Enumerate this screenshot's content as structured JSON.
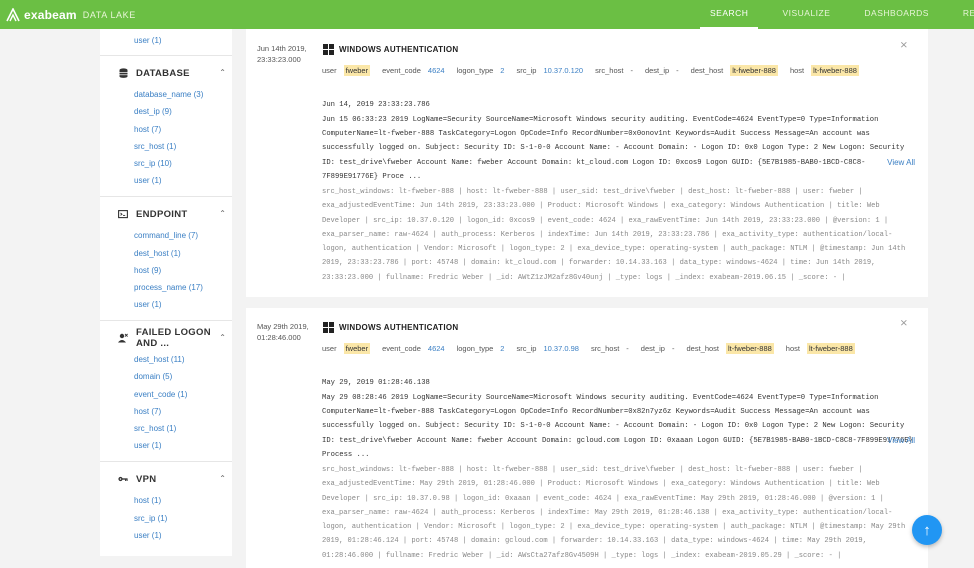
{
  "brand": {
    "name": "exabeam",
    "product": "DATA LAKE"
  },
  "nav": [
    "SEARCH",
    "VISUALIZE",
    "DASHBOARDS",
    "REPORTS"
  ],
  "sidebar": {
    "top_item": "user (1)",
    "database": {
      "title": "DATABASE",
      "items": [
        "database_name (3)",
        "dest_ip (9)",
        "host (7)",
        "src_host (1)",
        "src_ip (10)",
        "user (1)"
      ]
    },
    "endpoint": {
      "title": "ENDPOINT",
      "items": [
        "command_line (7)",
        "dest_host (1)",
        "host (9)",
        "process_name (17)",
        "user (1)"
      ]
    },
    "failed": {
      "title": "FAILED LOGON AND ...",
      "items": [
        "dest_host (11)",
        "domain (5)",
        "event_code (1)",
        "host (7)",
        "src_host (1)",
        "user (1)"
      ]
    },
    "vpn": {
      "title": "VPN",
      "items": [
        "host (1)",
        "src_ip (1)",
        "user (1)"
      ]
    }
  },
  "results": [
    {
      "date": "Jun 14th 2019,",
      "time": "23:33:23.000",
      "title": "WINDOWS AUTHENTICATION",
      "fields": {
        "user_k": "user",
        "user_v": "fweber",
        "ec_k": "event_code",
        "ec_v": "4624",
        "lt_k": "logon_type",
        "lt_v": "2",
        "si_k": "src_ip",
        "si_v": "10.37.0.120",
        "sh_k": "src_host",
        "sh_v": "-",
        "di_k": "dest_ip",
        "di_v": "-",
        "dh_k": "dest_host",
        "dh_v": "lt-fweber-888",
        "h_k": "host",
        "h_v": "lt-fweber-888"
      },
      "raw_time": "Jun 14, 2019 23:33:23.786",
      "raw": "Jun 15 06:33:23 2019 LogName=Security SourceName=Microsoft Windows security auditing. EventCode=4624 EventType=0 Type=Information ComputerName=lt-fweber-888 TaskCategory=Logon OpCode=Info RecordNumber=0x0onov1nt Keywords=Audit Success Message=An account was successfully logged on. Subject: Security ID: S-1-0-0 Account Name: - Account Domain: - Logon ID: 0x0 Logon Type: 2 New Logon: Security ID: test_drive\\fweber Account Name: fweber Account Domain: kt_cloud.com Logon ID: 0xcos9 Logon GUID: {5E7B1985-BAB0-1BCD-C8C8-7F899E91776E} Proce ...",
      "view_all": "View All",
      "kv": "src_host_windows: lt-fweber-888 | host: lt-fweber-888 | user_sid: test_drive\\fweber | dest_host: lt-fweber-888 | user: fweber | exa_adjustedEventTime: Jun 14th 2019, 23:33:23.000 | Product: Microsoft Windows | exa_category: Windows Authentication | title: Web Developer | src_ip: 10.37.0.120 | logon_id: 0xcos9 | event_code: 4624 | exa_rawEventTime: Jun 14th 2019, 23:33:23.000 | @version: 1 | exa_parser_name: raw-4624 | auth_process: Kerberos | indexTime: Jun 14th 2019, 23:33:23.786 | exa_activity_type: authentication/local-logon, authentication | Vendor: Microsoft | logon_type: 2 | exa_device_type: operating-system | auth_package: NTLM | @timestamp: Jun 14th 2019, 23:33:23.786 | port: 45748 | domain: kt_cloud.com | forwarder: 10.14.33.163 | data_type: windows-4624 | time: Jun 14th 2019, 23:33:23.000 | fullname: Fredric Weber | _id: AWtZ1zJM2afz8Gv40unj | _type: logs | _index: exabeam-2019.06.15 | _score: - |"
    },
    {
      "date": "May 29th 2019,",
      "time": "01:28:46.000",
      "title": "WINDOWS AUTHENTICATION",
      "fields": {
        "user_k": "user",
        "user_v": "fweber",
        "ec_k": "event_code",
        "ec_v": "4624",
        "lt_k": "logon_type",
        "lt_v": "2",
        "si_k": "src_ip",
        "si_v": "10.37.0.98",
        "sh_k": "src_host",
        "sh_v": "-",
        "di_k": "dest_ip",
        "di_v": "-",
        "dh_k": "dest_host",
        "dh_v": "lt-fweber-888",
        "h_k": "host",
        "h_v": "lt-fweber-888"
      },
      "raw_time": "May 29, 2019 01:28:46.138",
      "raw": "May 29 08:28:46 2019 LogName=Security SourceName=Microsoft Windows security auditing. EventCode=4624 EventType=0 Type=Information ComputerName=lt-fweber-888 TaskCategory=Logon OpCode=Info RecordNumber=0x82n7yz6z Keywords=Audit Success Message=An account was successfully logged on. Subject: Security ID: S-1-0-0 Account Name: - Account Domain: - Logon ID: 0x0 Logon Type: 2 New Logon: Security ID: test_drive\\fweber Account Name: fweber Account Domain: gcloud.com Logon ID: 0xaaan Logon GUID: {5E7B1985-BAB0-1BCD-C8C8-7F899E91776E} Process ...",
      "view_all": "View All",
      "kv": "src_host_windows: lt-fweber-888 | host: lt-fweber-888 | user_sid: test_drive\\fweber | dest_host: lt-fweber-888 | user: fweber | exa_adjustedEventTime: May 29th 2019, 01:28:46.000 | Product: Microsoft Windows | exa_category: Windows Authentication | title: Web Developer | src_ip: 10.37.0.98 | logon_id: 0xaaan | event_code: 4624 | exa_rawEventTime: May 29th 2019, 01:28:46.000 | @version: 1 | exa_parser_name: raw-4624 | auth_process: Kerberos | indexTime: May 29th 2019, 01:28:46.138 | exa_activity_type: authentication/local-logon, authentication | Vendor: Microsoft | logon_type: 2 | exa_device_type: operating-system | auth_package: NTLM | @timestamp: May 29th 2019, 01:28:46.124 | port: 45748 | domain: gcloud.com | forwarder: 10.14.33.163 | data_type: windows-4624 | time: May 29th 2019, 01:28:46.000 | fullname: Fredric Weber | _id: AWsCta27afz8Gv4509H | _type: logs | _index: exabeam-2019.05.29 | _score: - |"
    }
  ],
  "fab_icon": "arrow-up-icon"
}
